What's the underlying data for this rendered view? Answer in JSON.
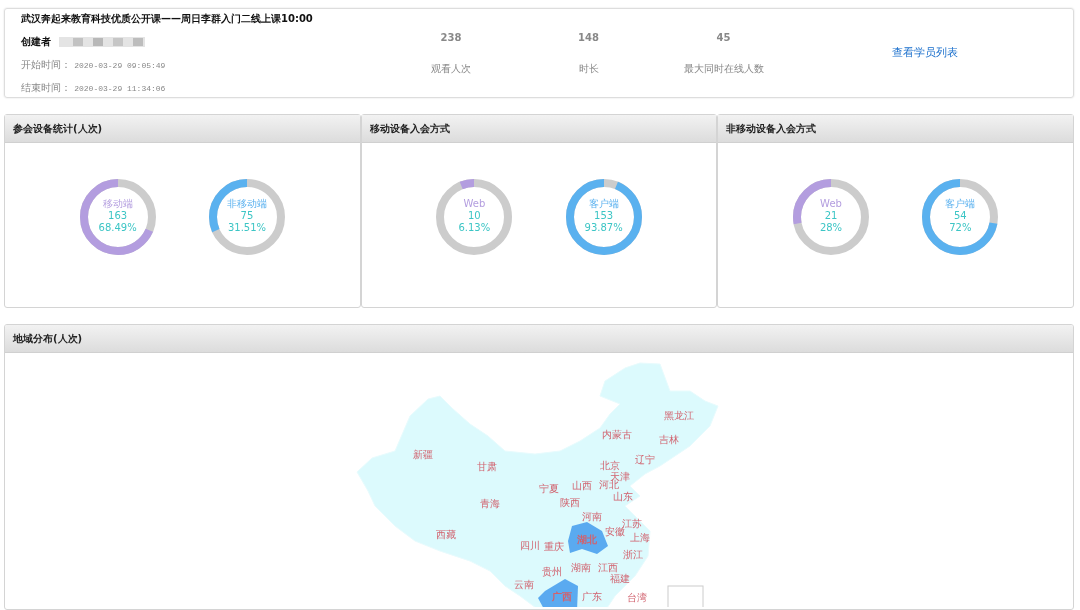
{
  "course": {
    "title": "武汉奔起来教育科技优质公开课——周日李群入门二线上课10:00",
    "creator_label": "创建者",
    "start_label": "开始时间：",
    "start_time": "2020-03-29 09:05:49",
    "end_label": "结束时间：",
    "end_time": "2020-03-29 11:34:06"
  },
  "stats": [
    {
      "value": "238",
      "label": "观看人次"
    },
    {
      "value": "148",
      "label": "时长"
    },
    {
      "value": "45",
      "label": "最大同时在线人数"
    }
  ],
  "student_list_link": "查看学员列表",
  "panels": [
    {
      "title": "参会设备统计(人次)",
      "donuts": [
        {
          "label": "移动端",
          "value": "163",
          "percent": "68.49%",
          "level": 0.6849,
          "color": "#b39ddf"
        },
        {
          "label": "非移动端",
          "value": "75",
          "percent": "31.51%",
          "level": 0.3151,
          "color": "#5ab1ef"
        }
      ]
    },
    {
      "title": "移动设备入会方式",
      "donuts": [
        {
          "label": "Web",
          "value": "10",
          "percent": "6.13%",
          "level": 0.0613,
          "color": "#b39ddf"
        },
        {
          "label": "客户端",
          "value": "153",
          "percent": "93.87%",
          "level": 0.9387,
          "color": "#5ab1ef"
        }
      ]
    },
    {
      "title": "非移动设备入会方式",
      "donuts": [
        {
          "label": "Web",
          "value": "21",
          "percent": "28%",
          "level": 0.28,
          "color": "#b39ddf"
        },
        {
          "label": "客户端",
          "value": "54",
          "percent": "72%",
          "level": 0.72,
          "color": "#5ab1ef"
        }
      ]
    }
  ],
  "map_panel": {
    "title": "地域分布(人次)",
    "regions": [
      {
        "name": "黑龙江",
        "highlighted": false
      },
      {
        "name": "内蒙古",
        "highlighted": false
      },
      {
        "name": "吉林",
        "highlighted": false
      },
      {
        "name": "新疆",
        "highlighted": false
      },
      {
        "name": "辽宁",
        "highlighted": false
      },
      {
        "name": "甘肃",
        "highlighted": false
      },
      {
        "name": "北京",
        "highlighted": false
      },
      {
        "name": "天津",
        "highlighted": false
      },
      {
        "name": "宁夏",
        "highlighted": false
      },
      {
        "name": "山西",
        "highlighted": false
      },
      {
        "name": "河北",
        "highlighted": false
      },
      {
        "name": "山东",
        "highlighted": false
      },
      {
        "name": "青海",
        "highlighted": false
      },
      {
        "name": "陕西",
        "highlighted": false
      },
      {
        "name": "河南",
        "highlighted": false
      },
      {
        "name": "江苏",
        "highlighted": false
      },
      {
        "name": "西藏",
        "highlighted": false
      },
      {
        "name": "四川",
        "highlighted": false
      },
      {
        "name": "重庆",
        "highlighted": false
      },
      {
        "name": "湖北",
        "highlighted": true
      },
      {
        "name": "安徽",
        "highlighted": false
      },
      {
        "name": "上海",
        "highlighted": false
      },
      {
        "name": "浙江",
        "highlighted": false
      },
      {
        "name": "贵州",
        "highlighted": false
      },
      {
        "name": "湖南",
        "highlighted": false
      },
      {
        "name": "江西",
        "highlighted": false
      },
      {
        "name": "福建",
        "highlighted": false
      },
      {
        "name": "云南",
        "highlighted": false
      },
      {
        "name": "广西",
        "highlighted": true
      },
      {
        "name": "广东",
        "highlighted": false
      },
      {
        "name": "台湾",
        "highlighted": false
      }
    ]
  }
}
